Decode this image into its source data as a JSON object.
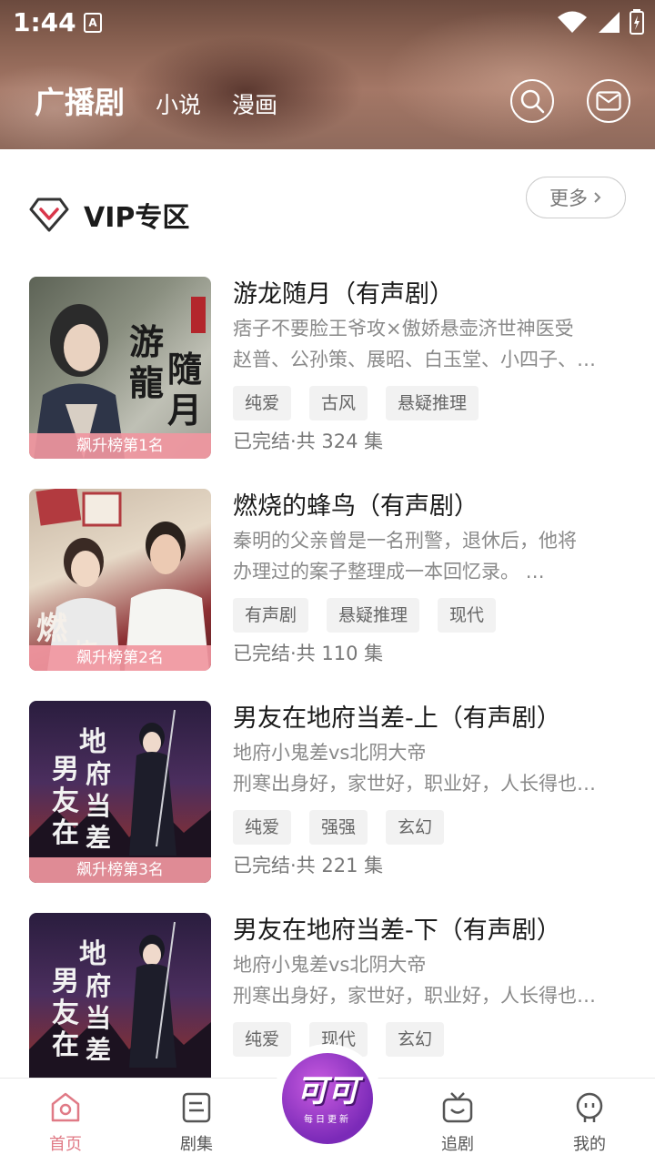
{
  "statusbar": {
    "time": "1:44",
    "a_badge": "A"
  },
  "topnav": {
    "active": "广播剧",
    "tabs": [
      "小说",
      "漫画"
    ]
  },
  "section": {
    "title": "VIP专区",
    "more": "更多"
  },
  "items": [
    {
      "title": "游龙随月（有声剧）",
      "desc1": "痞子不要脸王爷攻×傲娇悬壶济世神医受",
      "desc2": "赵普、公孙策、展昭、白玉堂、小四子、…",
      "tags": [
        "纯爱",
        "古风",
        "悬疑推理"
      ],
      "status": "已完结·共 324 集",
      "rank": "飙升榜第1名",
      "cover_text": "游龍隨月"
    },
    {
      "title": "燃烧的蜂鸟（有声剧）",
      "desc1": "秦明的父亲曾是一名刑警，退休后，他将",
      "desc2": "办理过的案子整理成一本回忆录。 …",
      "tags": [
        "有声剧",
        "悬疑推理",
        "现代"
      ],
      "status": "已完结·共 110 集",
      "rank": "飙升榜第2名",
      "cover_text": "燃烧"
    },
    {
      "title": "男友在地府当差-上（有声剧）",
      "desc1": "地府小鬼差vs北阴大帝",
      "desc2": "刑寒出身好，家世好，职业好，人长得也…",
      "tags": [
        "纯爱",
        "强强",
        "玄幻"
      ],
      "status": "已完结·共 221 集",
      "rank": "飙升榜第3名",
      "cover_text": "男友在地府当差"
    },
    {
      "title": "男友在地府当差-下（有声剧）",
      "desc1": "地府小鬼差vs北阴大帝",
      "desc2": "刑寒出身好，家世好，职业好，人长得也…",
      "tags": [
        "纯爱",
        "现代",
        "玄幻"
      ],
      "status": "",
      "rank": "",
      "cover_text": "男友在地府当差"
    }
  ],
  "bottomnav": {
    "home": "首页",
    "drama": "剧集",
    "center_big": "可可",
    "center_small": "每日更新",
    "follow": "追剧",
    "mine": "我的"
  },
  "colors": {
    "accent": "#e07a86",
    "vip": "#d9364a",
    "purple": "#8a2fc4"
  }
}
